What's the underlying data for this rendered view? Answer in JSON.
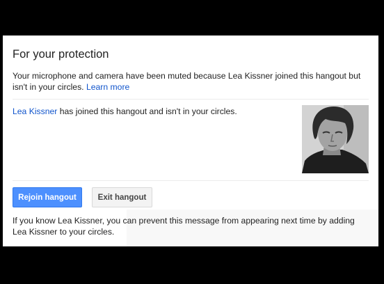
{
  "dialog": {
    "title": "For your protection",
    "message": {
      "text": "Your microphone and camera have been muted because Lea Kissner joined this hangout but isn't in your circles.",
      "link": "Learn more"
    },
    "joined": {
      "name": "Lea Kissner",
      "text": "has joined this hangout and isn't in your circles."
    },
    "avatar_icon": "user-photo",
    "buttons": {
      "rejoin": "Rejoin hangout",
      "exit": "Exit hangout"
    },
    "tip": "If you know Lea Kissner, you can prevent this message from appearing next time by adding Lea Kissner to your circles."
  },
  "colors": {
    "background": "#000000",
    "dialog": "#ffffff",
    "link": "#1155cc",
    "primary_button": "#4d90fe",
    "secondary_button": "#f3f3f3"
  }
}
